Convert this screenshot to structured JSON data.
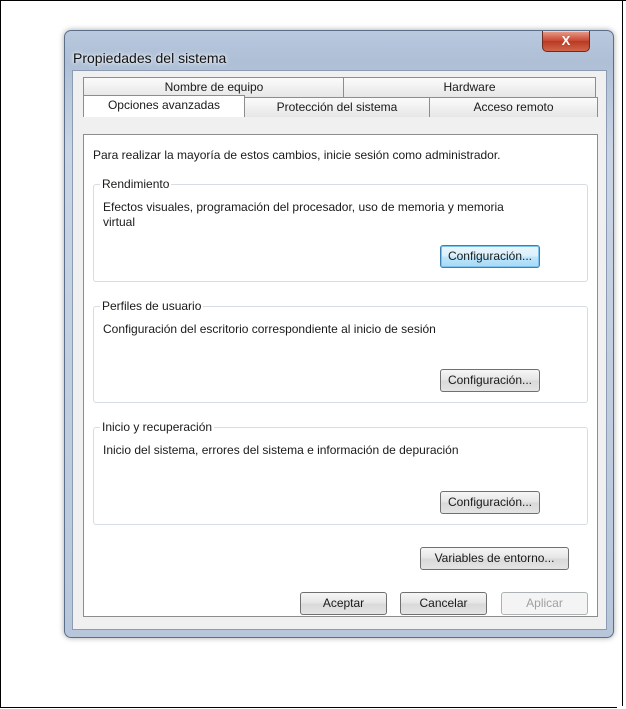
{
  "window": {
    "title": "Propiedades del sistema",
    "close_label": "X"
  },
  "tabs": {
    "row1": [
      {
        "label": "Nombre de equipo"
      },
      {
        "label": "Hardware"
      }
    ],
    "row2": [
      {
        "label": "Opciones avanzadas",
        "selected": true
      },
      {
        "label": "Protección del sistema"
      },
      {
        "label": "Acceso remoto"
      }
    ]
  },
  "panel": {
    "intro": "Para realizar la mayoría de estos cambios, inicie sesión como administrador.",
    "groups": [
      {
        "label": "Rendimiento",
        "description": "Efectos visuales, programación del procesador, uso de memoria y memoria virtual",
        "button": "Configuración..."
      },
      {
        "label": "Perfiles de usuario",
        "description": "Configuración del escritorio correspondiente al inicio de sesión",
        "button": "Configuración..."
      },
      {
        "label": "Inicio y recuperación",
        "description": "Inicio del sistema, errores del sistema e información de depuración",
        "button": "Configuración..."
      }
    ],
    "env_button": "Variables de entorno..."
  },
  "footer": {
    "ok": "Aceptar",
    "cancel": "Cancelar",
    "apply": "Aplicar",
    "apply_enabled": false
  }
}
